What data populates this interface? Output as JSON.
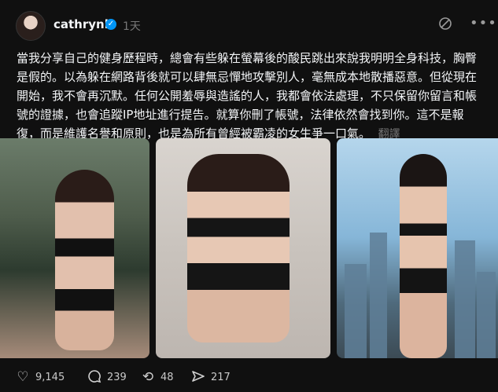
{
  "header": {
    "username": "cathrynli",
    "verified_icon": "verified-badge-icon",
    "time": "1天",
    "icons": [
      "translate-off-icon",
      "more-icon"
    ]
  },
  "post": {
    "text": "當我分享自己的健身歷程時，總會有些躲在螢幕後的酸民跳出來說我明明全身科技，胸臀是假的。以為躲在網路背後就可以肆無忌憚地攻擊別人，毫無成本地散播惡意。但從現在開始，我不會再沉默。任何公開羞辱與造謠的人，我都會依法處理，不只保留你留言和帳號的證據，也會追蹤IP地址進行提告。就算你刪了帳號，法律依然會找到你。這不是報復，而是維護名譽和原則，也是為所有曾經被霸凌的女生爭一口氣。",
    "translate_label": "翻譯"
  },
  "images": [
    {
      "name": "gym-photo-1"
    },
    {
      "name": "gym-photo-2"
    },
    {
      "name": "city-photo-3"
    }
  ],
  "actions": {
    "like_count": "9,145",
    "reply_count": "239",
    "repost_count": "48",
    "share_count": "217",
    "icons": [
      "heart-icon",
      "comment-icon",
      "repost-icon",
      "share-icon"
    ]
  },
  "colors": {
    "background": "#101010",
    "text": "#f3f5f7",
    "muted": "#777777",
    "verified": "#0095f6"
  }
}
